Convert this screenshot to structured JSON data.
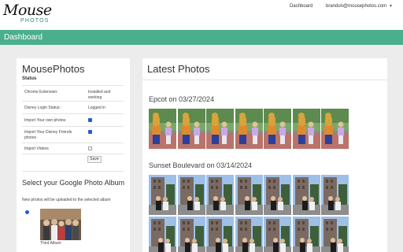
{
  "brand": {
    "name": "Mouse",
    "sub": "PHOTOS"
  },
  "nav": {
    "dashboard": "Dashboard",
    "user": "brandon@mousephotos.com",
    "caret": "▼"
  },
  "page": {
    "title": "Dashboard"
  },
  "left": {
    "title": "MousePhotos",
    "status_heading": "Status",
    "rows": [
      {
        "label": "Chrome Extension:",
        "value": "Installed and working"
      },
      {
        "label": "Disney Login Status:",
        "value": "Logged in"
      },
      {
        "label": "Import Your own photos",
        "checked": true
      },
      {
        "label": "Import Your Disney Friends photos",
        "checked": true
      },
      {
        "label": "Import Videos",
        "checked": false
      }
    ],
    "save_label": "Save",
    "select_title": "Select your Google Photo Album",
    "select_sub": "New photos will be uploaded to the selected album",
    "album_name": "Third Album"
  },
  "right": {
    "title": "Latest Photos",
    "albums": [
      {
        "heading": "Epcot on 03/27/2024",
        "count": 7,
        "scene": "epcot"
      },
      {
        "heading": "Sunset Boulevard on 03/14/2024",
        "count": 7,
        "scene": "sunset"
      }
    ]
  },
  "colors": {
    "accent": "#4aaf8d",
    "brand_sub": "#2a8f72",
    "checkbox": "#1f5fd6"
  }
}
